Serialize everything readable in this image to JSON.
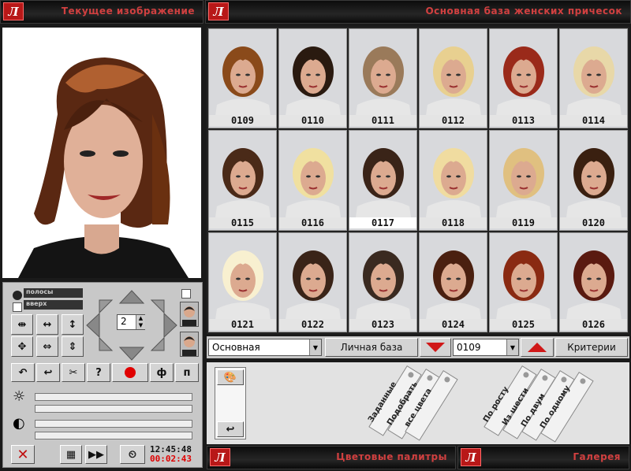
{
  "header": {
    "logo_glyph": "Л",
    "left_title": "Текущее изображение",
    "right_title": "Основная база женских причесок"
  },
  "grid": {
    "items": [
      "0109",
      "0110",
      "0111",
      "0112",
      "0113",
      "0114",
      "0115",
      "0116",
      "0117",
      "0118",
      "0119",
      "0120",
      "0121",
      "0122",
      "0123",
      "0124",
      "0125",
      "0126"
    ],
    "selected": "0117",
    "hair_colors": [
      "#8a4a1a",
      "#2a1a10",
      "#9a7a5a",
      "#e8d090",
      "#9a2a1a",
      "#e8d8a8",
      "#4a2a18",
      "#f0e0a0",
      "#3a2418",
      "#f0dca0",
      "#e0c080",
      "#3a2010",
      "#f8f0d0",
      "#3a2418",
      "#3a2a20",
      "#4a2010",
      "#8a2a12",
      "#5a1a10"
    ]
  },
  "controls": {
    "radio1_label": "полосы",
    "radio2_label": "вверх",
    "step_value": "2",
    "help_label": "?",
    "tool_p1": "ф",
    "tool_p2": "п",
    "time": "12:45:48",
    "timer": "00:02:43",
    "colors": {
      "record": "#e00000",
      "close": "#c01010",
      "timer": "#e00000"
    }
  },
  "selector": {
    "base_value": "Основная",
    "personal_base_label": "Личная база",
    "number_value": "0109",
    "criteria_label": "Критерии"
  },
  "palette_tabs": [
    "Заданные",
    "Подобрать",
    "все цвета",
    "По росту",
    "Из шести",
    "По двум",
    "По одному"
  ],
  "footer": {
    "left_title": "Цветовые палитры",
    "right_title": "Галерея"
  }
}
